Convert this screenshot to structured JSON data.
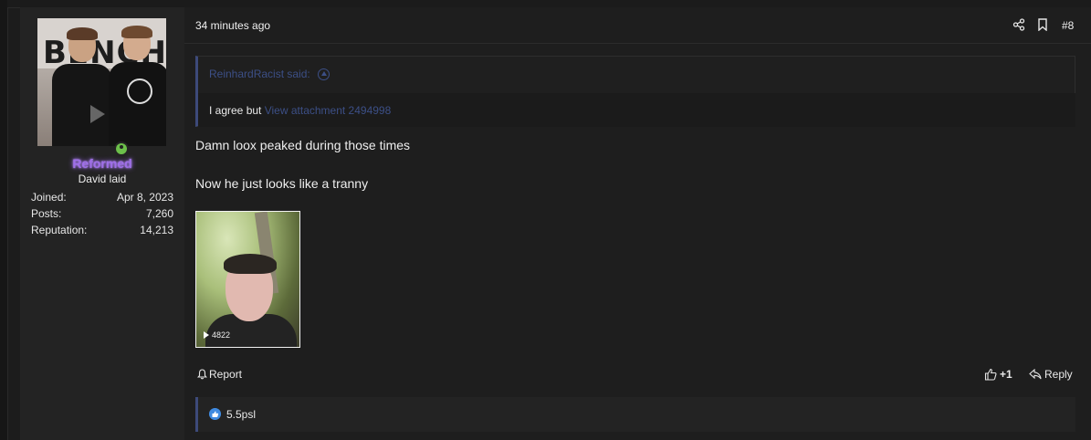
{
  "user": {
    "name": "Reformed",
    "title": "David laid",
    "stats": [
      {
        "label": "Joined:",
        "value": "Apr 8, 2023"
      },
      {
        "label": "Posts:",
        "value": "7,260"
      },
      {
        "label": "Reputation:",
        "value": "14,213"
      }
    ]
  },
  "post": {
    "time": "34 minutes ago",
    "number": "#8",
    "quote": {
      "author": "ReinhardRacist said:",
      "text": "I agree but",
      "link": "View attachment 2494998"
    },
    "lines": [
      "Damn loox peaked during those times",
      "Now he just looks like a tranny"
    ],
    "attachment": {
      "views": "4822"
    }
  },
  "actions": {
    "report": "Report",
    "like": "+1",
    "reply": "Reply"
  },
  "reactions": {
    "text": "5.5psl",
    "color": "#3f8ae0"
  },
  "colors": {
    "username": "#9f6fe8",
    "quote_link": "#3c4f86",
    "online": "#6cc04a"
  }
}
